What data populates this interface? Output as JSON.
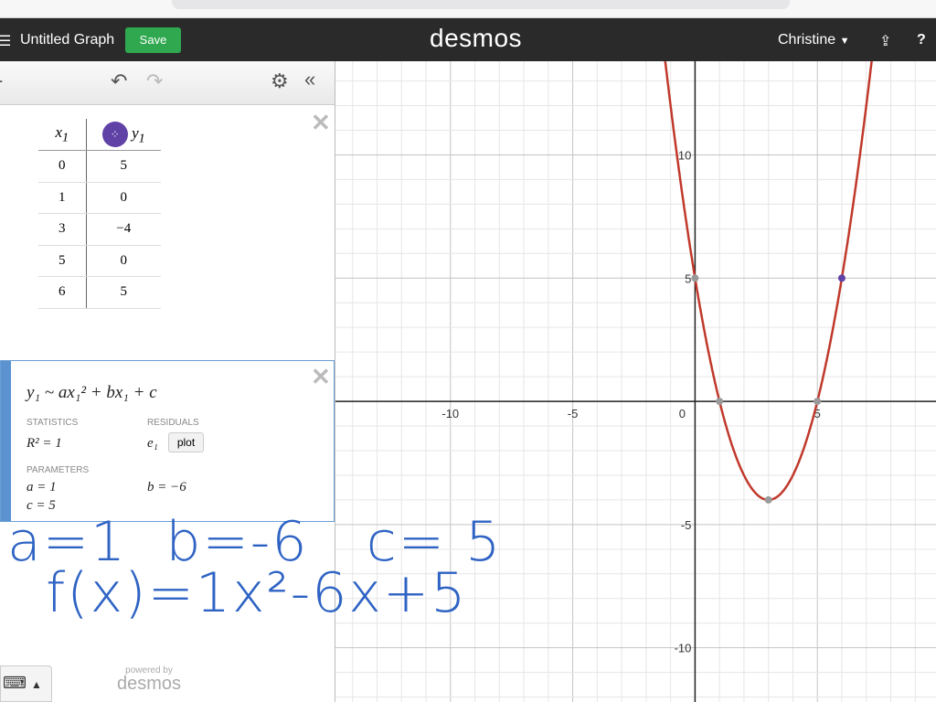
{
  "header": {
    "title": "Untitled Graph",
    "save_label": "Save",
    "logo": "desmos",
    "user": "Christine"
  },
  "table": {
    "headers": [
      "x1",
      "y1"
    ],
    "rows": [
      [
        "0",
        "5"
      ],
      [
        "1",
        "0"
      ],
      [
        "3",
        "−4"
      ],
      [
        "5",
        "0"
      ],
      [
        "6",
        "5"
      ]
    ],
    "point_color": "#6042a6"
  },
  "regression": {
    "expression": "y₁ ~ ax₁² + bx₁ + c",
    "statistics_label": "STATISTICS",
    "r2": "R² = 1",
    "residuals_label": "RESIDUALS",
    "residual_var": "e₁",
    "plot_label": "plot",
    "parameters_label": "PARAMETERS",
    "a": "a = 1",
    "b": "b = −6",
    "c": "c = 5"
  },
  "handwriting": {
    "line1": "a=1  b=-6   c= 5",
    "line2": "  f(x)=1x²-6x+5"
  },
  "footer": {
    "powered_by": "powered by",
    "brand": "desmos"
  },
  "graph": {
    "xlim": [
      -14.7,
      9.85
    ],
    "ylim": [
      -12.2,
      13.8
    ],
    "x_ticks": [
      "-10",
      "-5",
      "0",
      "5"
    ],
    "y_ticks": [
      "10",
      "5",
      "-5",
      "-10"
    ],
    "curve": {
      "a": 1,
      "b": -6,
      "c": 5,
      "color": "#c0392b"
    },
    "point_color": "#9a9a9a"
  }
}
